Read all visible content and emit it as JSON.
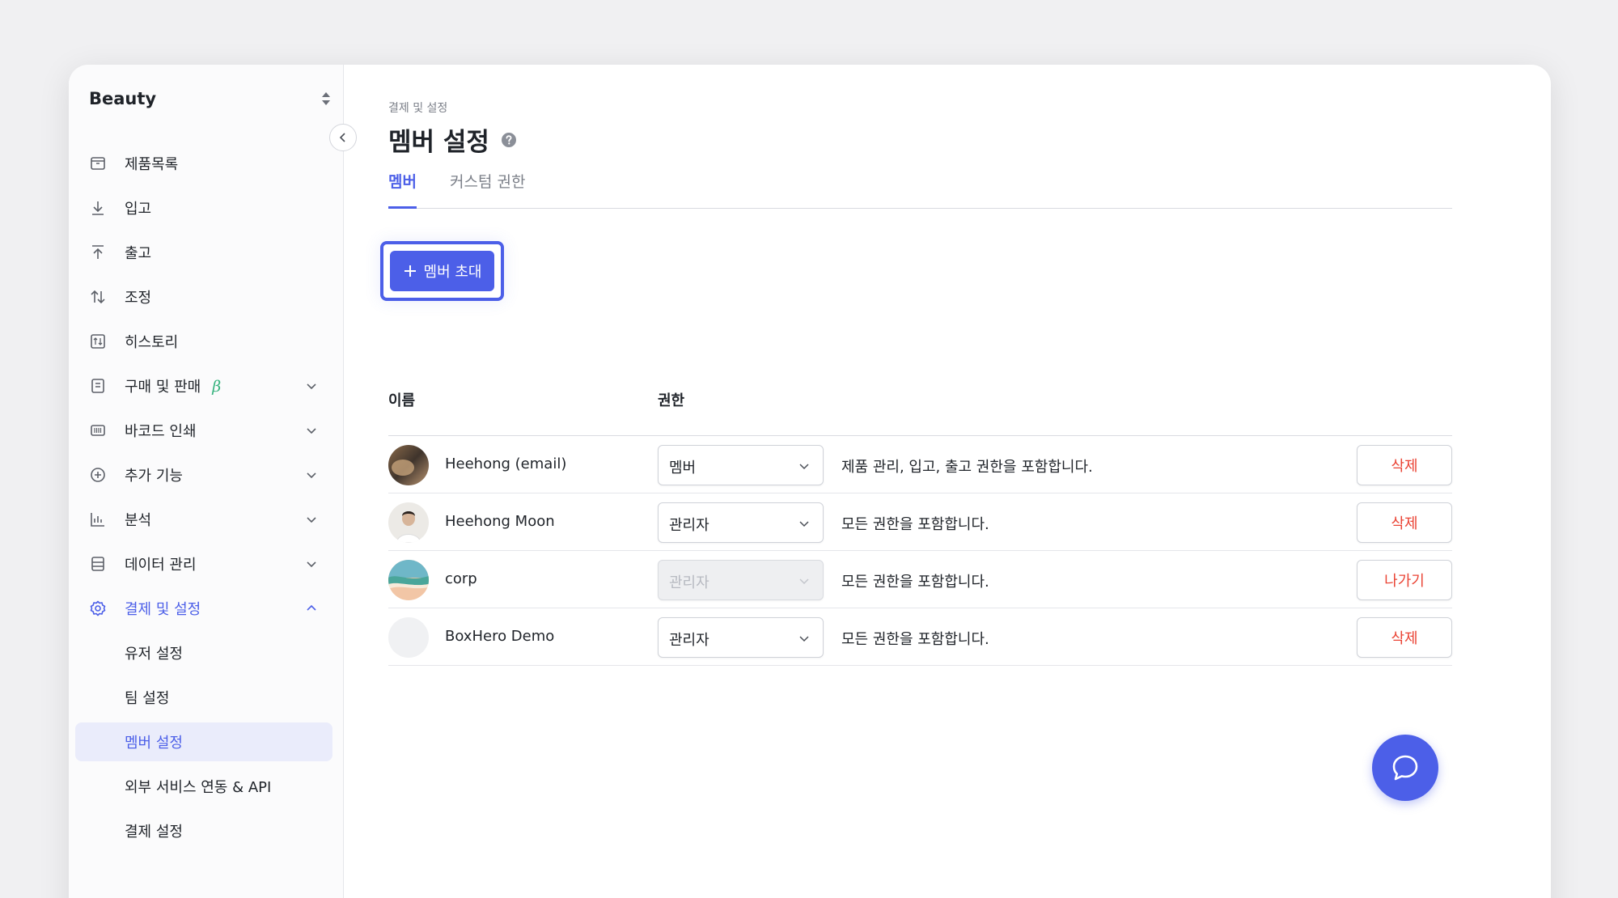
{
  "sidebar": {
    "team_name": "Beauty",
    "items": [
      {
        "label": "제품목록",
        "icon": "box-icon"
      },
      {
        "label": "입고",
        "icon": "arrow-down-icon"
      },
      {
        "label": "출고",
        "icon": "arrow-up-icon"
      },
      {
        "label": "조정",
        "icon": "swap-icon"
      },
      {
        "label": "히스토리",
        "icon": "history-icon"
      },
      {
        "label": "구매 및 판매",
        "icon": "document-icon",
        "badge": "β"
      },
      {
        "label": "바코드 인쇄",
        "icon": "barcode-icon"
      },
      {
        "label": "추가 기능",
        "icon": "plus-circle-icon"
      },
      {
        "label": "분석",
        "icon": "chart-icon"
      },
      {
        "label": "데이터 관리",
        "icon": "database-icon"
      },
      {
        "label": "결제 및 설정",
        "icon": "gear-icon"
      }
    ],
    "sub_items": [
      {
        "label": "유저 설정"
      },
      {
        "label": "팀 설정"
      },
      {
        "label": "멤버 설정"
      },
      {
        "label": "외부 서비스 연동 & API"
      },
      {
        "label": "결제 설정"
      }
    ]
  },
  "main": {
    "breadcrumb": "결제 및 설정",
    "title": "멤버 설정",
    "tabs": [
      {
        "label": "멤버"
      },
      {
        "label": "커스텀 권한"
      }
    ],
    "invite_button": "멤버 초대",
    "columns": {
      "name": "이름",
      "role": "권한"
    },
    "members": [
      {
        "name": "Heehong (email)",
        "role": "멤버",
        "description": "제품 관리, 입고, 출고 권한을 포함합니다.",
        "action": "삭제",
        "role_disabled": false
      },
      {
        "name": "Heehong Moon",
        "role": "관리자",
        "description": "모든 권한을 포함합니다.",
        "action": "삭제",
        "role_disabled": false
      },
      {
        "name": "corp",
        "role": "관리자",
        "description": "모든 권한을 포함합니다.",
        "action": "나가기",
        "role_disabled": true
      },
      {
        "name": "BoxHero Demo",
        "role": "관리자",
        "description": "모든 권한을 포함합니다.",
        "action": "삭제",
        "role_disabled": false
      }
    ]
  },
  "colors": {
    "accent": "#4c5fe8",
    "danger": "#ea4334",
    "beta": "#36b37e"
  }
}
